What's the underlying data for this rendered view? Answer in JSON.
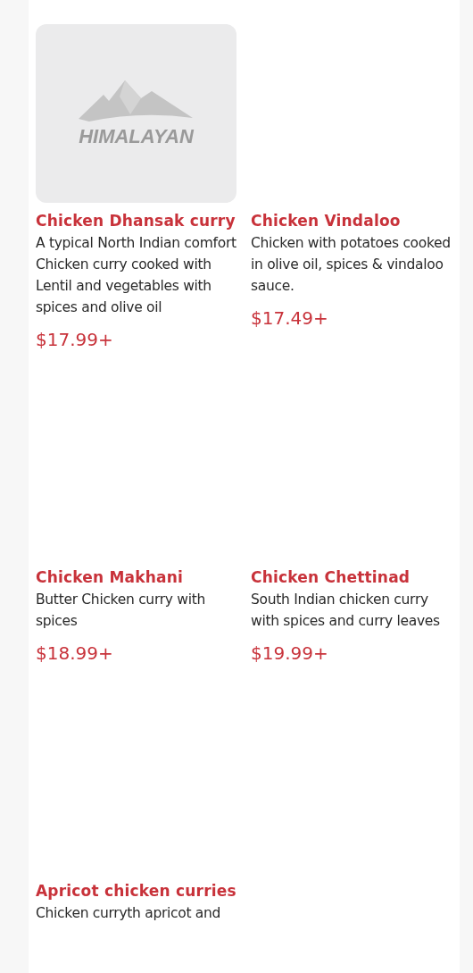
{
  "menu_items": [
    {
      "image": {
        "kind": "logo",
        "text": "HIMALAYAN"
      },
      "name": "Chicken Dhansak curry",
      "description": "A typical North Indian comfort Chicken curry cooked with Lentil and vegetables with spices and olive oil",
      "price": "$17.99+"
    },
    {
      "name": "Chicken Vindaloo",
      "description": "Chicken with potatoes cooked in olive oil, spices & vindaloo sauce.",
      "price": "$17.49+"
    },
    {
      "name": "Chicken Makhani",
      "description": "Butter Chicken curry with spices",
      "price": "$18.99+"
    },
    {
      "name": "Chicken Chettinad",
      "description": "South Indian chicken curry with spices and curry leaves",
      "price": "$19.99+"
    },
    {
      "name": "Apricot chicken curries",
      "description": "Chicken curryth apricot and"
    }
  ]
}
